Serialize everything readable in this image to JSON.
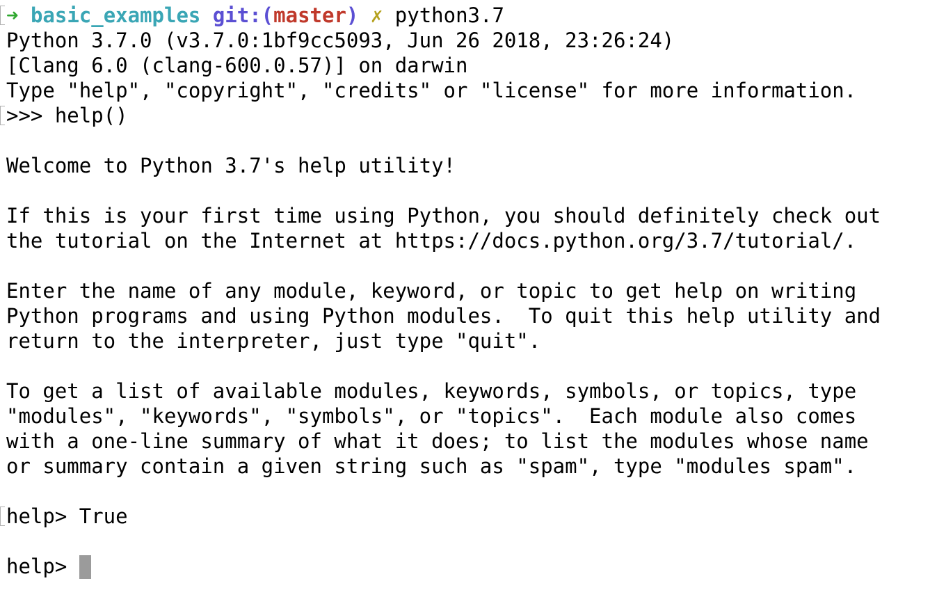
{
  "prompt": {
    "arrow": "➜",
    "directory": "basic_examples",
    "git_label": "git:(",
    "branch": "master",
    "git_close": ")",
    "dirty_mark": "✗",
    "command": "python3.7"
  },
  "output_lines": [
    "Python 3.7.0 (v3.7.0:1bf9cc5093, Jun 26 2018, 23:26:24)",
    "[Clang 6.0 (clang-600.0.57)] on darwin",
    "Type \"help\", \"copyright\", \"credits\" or \"license\" for more information.",
    ">>> help()",
    "",
    "Welcome to Python 3.7's help utility!",
    "",
    "If this is your first time using Python, you should definitely check out",
    "the tutorial on the Internet at https://docs.python.org/3.7/tutorial/.",
    "",
    "Enter the name of any module, keyword, or topic to get help on writing",
    "Python programs and using Python modules.  To quit this help utility and",
    "return to the interpreter, just type \"quit\".",
    "",
    "To get a list of available modules, keywords, symbols, or topics, type",
    "\"modules\", \"keywords\", \"symbols\", or \"topics\".  Each module also comes",
    "with a one-line summary of what it does; to list the modules whose name",
    "or summary contain a given string such as \"spam\", type \"modules spam\".",
    "",
    "help> True",
    ""
  ],
  "input_prompt": "help> ",
  "colors": {
    "arrow": "#2fa82f",
    "directory": "#3aa6b5",
    "git": "#5b4fd3",
    "branch": "#c0392b",
    "dirty": "#b5a21f",
    "cursor": "#9b9b9b"
  }
}
